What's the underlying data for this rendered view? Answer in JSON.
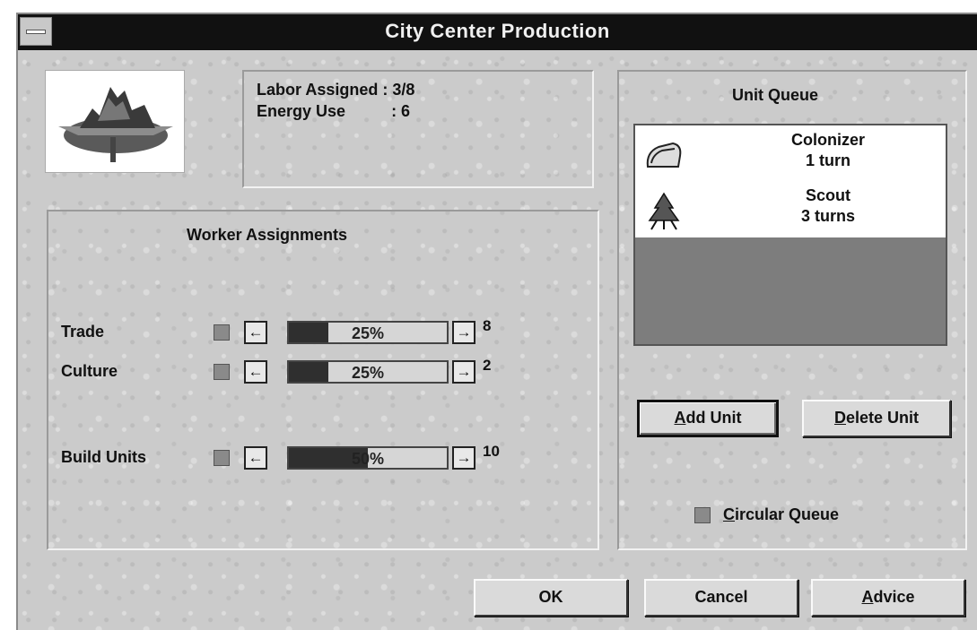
{
  "window": {
    "title": "City Center Production"
  },
  "info": {
    "labor_label": "Labor Assigned",
    "labor_value": ": 3/8",
    "energy_label": "Energy Use",
    "energy_value": ": 6"
  },
  "workers": {
    "title": "Worker Assignments",
    "rows": [
      {
        "label": "Trade",
        "percent_text": "25%",
        "fill": 0.25,
        "value": "8"
      },
      {
        "label": "Culture",
        "percent_text": "25%",
        "fill": 0.25,
        "value": "2"
      },
      {
        "label": "Build Units",
        "percent_text": "50%",
        "fill": 0.5,
        "value": "10"
      }
    ],
    "decrease_glyph": "←",
    "increase_glyph": "→"
  },
  "queue": {
    "title": "Unit Queue",
    "items": [
      {
        "name": "Colonizer",
        "turns": "1 turn",
        "icon": "colonizer-icon"
      },
      {
        "name": "Scout",
        "turns": "3 turns",
        "icon": "scout-icon"
      }
    ],
    "add_button": {
      "mnemonic": "A",
      "rest": "dd Unit"
    },
    "delete_button": {
      "mnemonic": "D",
      "rest": "elete Unit"
    },
    "circular": {
      "mnemonic": "C",
      "rest": "ircular Queue"
    }
  },
  "footer": {
    "ok": "OK",
    "cancel": "Cancel",
    "advice": {
      "mnemonic": "A",
      "rest": "dvice"
    }
  },
  "colors": {
    "titlebar": "#111111",
    "face": "#c9c9c9",
    "slider_fill": "#2f2f2f",
    "queue_empty": "#7d7d7d"
  }
}
